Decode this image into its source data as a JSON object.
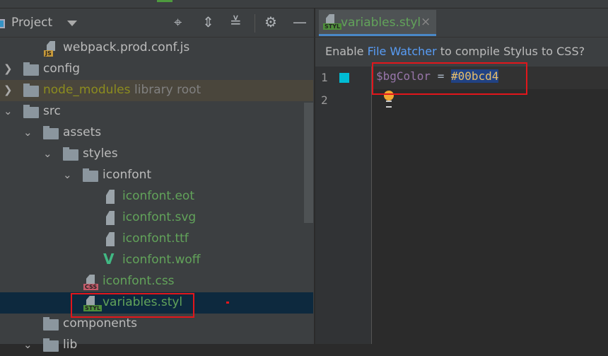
{
  "project_panel": {
    "title": "Project",
    "toolbar_icons": [
      "locate-icon",
      "expand-all-icon",
      "collapse-all-icon",
      "gear-icon",
      "minimize-icon"
    ],
    "tree": [
      {
        "label": "webpack.prod.conf.js",
        "type": "file",
        "badge": "JS"
      },
      {
        "label": "config",
        "type": "folder"
      },
      {
        "label": "node_modules",
        "suffix": "library root",
        "type": "folder"
      },
      {
        "label": "src",
        "type": "folder"
      },
      {
        "label": "assets",
        "type": "folder"
      },
      {
        "label": "styles",
        "type": "folder"
      },
      {
        "label": "iconfont",
        "type": "folder"
      },
      {
        "label": "iconfont.eot",
        "type": "file"
      },
      {
        "label": "iconfont.svg",
        "type": "file"
      },
      {
        "label": "iconfont.ttf",
        "type": "file"
      },
      {
        "label": "iconfont.woff",
        "type": "file"
      },
      {
        "label": "iconfont.css",
        "type": "file",
        "badge": "CSS"
      },
      {
        "label": "variables.styl",
        "type": "file",
        "badge": "STYL",
        "selected": true
      },
      {
        "label": "components",
        "type": "folder"
      },
      {
        "label": "lib",
        "type": "folder"
      }
    ]
  },
  "editor": {
    "tab": {
      "label": "variables.styl",
      "badge": "STYL"
    },
    "banner": {
      "prefix": "Enable ",
      "link": "File Watcher",
      "suffix": " to compile Stylus to CSS?"
    },
    "line_numbers": [
      "1",
      "2"
    ],
    "code": {
      "variable": "$bgColor",
      "operator": " = ",
      "value": "#00bcd4"
    },
    "swatch_color": "#00bcd4"
  }
}
